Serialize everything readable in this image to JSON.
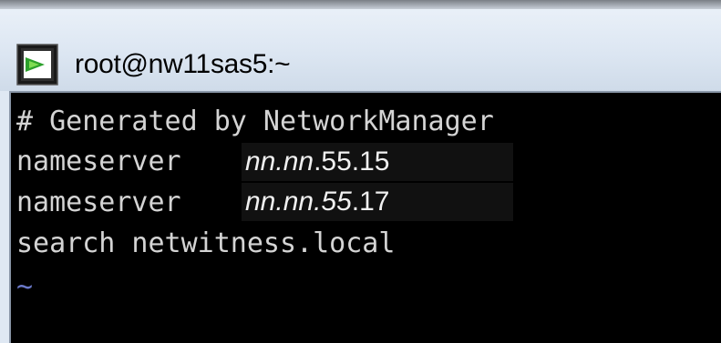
{
  "window": {
    "title": "root@nw11sas5:~",
    "icon": "terminal-prompt-icon"
  },
  "terminal": {
    "line1": "# Generated by NetworkManager",
    "line2_keyword": "nameserver",
    "line2_ip_italic": "nn.nn",
    "line2_ip_rest": ".55.15",
    "line3_keyword": "nameserver",
    "line3_ip_italic": "nn.nn.55",
    "line3_ip_rest": ".17",
    "line4": "search netwitness.local",
    "empty_line_marker": "~"
  },
  "colors": {
    "terminal_bg": "#000000",
    "terminal_fg": "#d4d4d4",
    "tilde": "#6a78c8",
    "titlebar": "#dce6f2"
  }
}
